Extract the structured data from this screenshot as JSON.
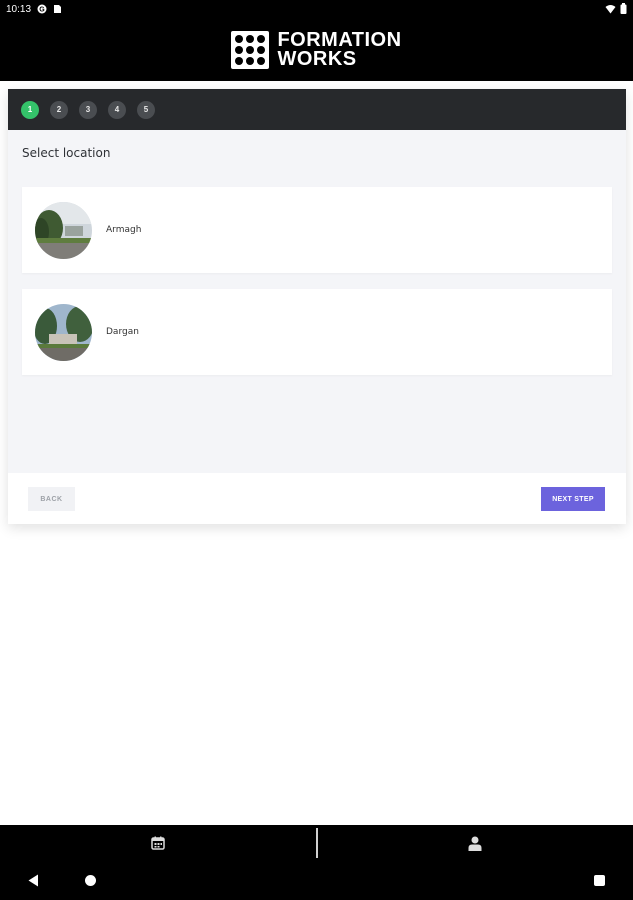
{
  "status_bar": {
    "time": "10:13",
    "icons_left": [
      "google-g-icon",
      "sim-card-icon"
    ],
    "icons_right": [
      "wifi-icon",
      "battery-icon"
    ]
  },
  "header": {
    "logo_line1": "FORMATION",
    "logo_line2": "WORKS"
  },
  "steps": [
    {
      "label": "1",
      "active": true
    },
    {
      "label": "2",
      "active": false
    },
    {
      "label": "3",
      "active": false
    },
    {
      "label": "4",
      "active": false
    },
    {
      "label": "5",
      "active": false
    }
  ],
  "section_title": "Select location",
  "locations": [
    {
      "name": "Armagh"
    },
    {
      "name": "Dargan"
    }
  ],
  "footer": {
    "back_label": "BACK",
    "next_label": "NEXT STEP"
  },
  "bottom_nav": {
    "tabs": [
      "calendar-icon",
      "user-icon"
    ]
  },
  "colors": {
    "accent": "#6c63dd",
    "active_step": "#34c26a",
    "dark_bar": "#27292c"
  }
}
